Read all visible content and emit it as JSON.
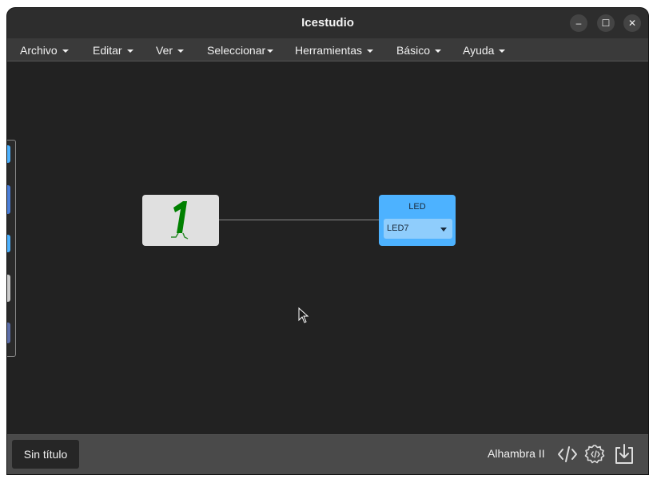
{
  "window": {
    "title": "Icestudio",
    "controls": {
      "minimize": "–",
      "maximize": "☐",
      "close": "✕"
    }
  },
  "menu": {
    "items": [
      {
        "label": "Archivo"
      },
      {
        "label": "Editar"
      },
      {
        "label": "Ver"
      },
      {
        "label": "Seleccionar"
      },
      {
        "label": "Herramientas"
      },
      {
        "label": "Básico"
      },
      {
        "label": "Ayuda"
      }
    ]
  },
  "canvas": {
    "constant_block": {
      "icon": "constant-one-walking-icon",
      "color": "#008000"
    },
    "led_block": {
      "label": "LED",
      "selected_pin": "LED7",
      "color": "#4db2ff"
    }
  },
  "footer": {
    "project_title": "Sin título",
    "board_name": "Alhambra II",
    "icons": [
      "code-icon",
      "verify-gear-icon",
      "upload-icon"
    ]
  },
  "colors": {
    "canvas_background": "#222222",
    "menubar": "#3a3a3a",
    "footer": "#4a4a4a",
    "led_block": "#4db2ff",
    "constant_block": "#e0e0e0"
  }
}
